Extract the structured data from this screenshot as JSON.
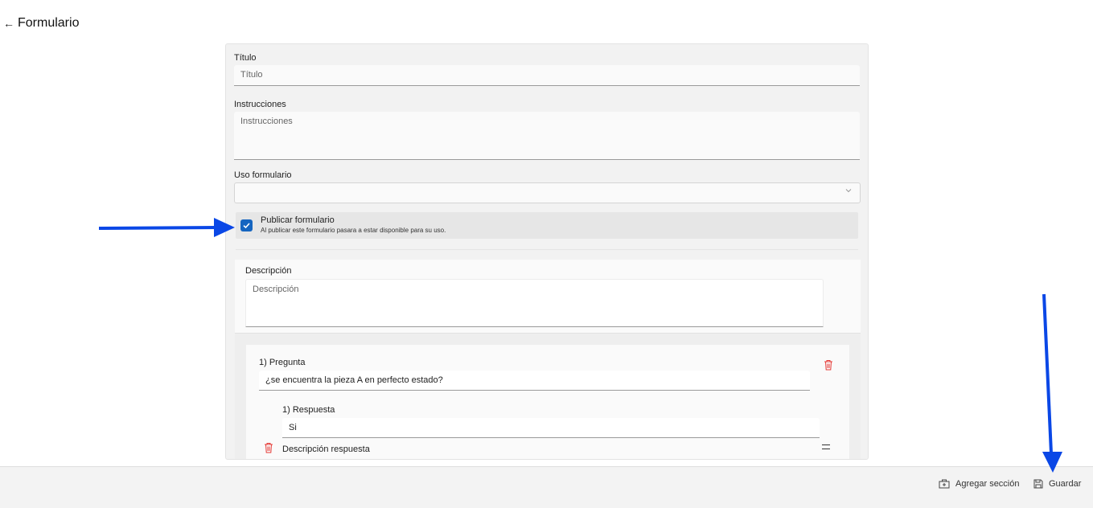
{
  "header": {
    "back_icon": "arrow-left-icon",
    "title": "Formulario"
  },
  "form": {
    "titulo_label": "Título",
    "titulo_placeholder": "Título",
    "instrucciones_label": "Instrucciones",
    "instrucciones_placeholder": "Instrucciones",
    "uso_label": "Uso formulario",
    "uso_value": "",
    "publicar_label": "Publicar formulario",
    "publicar_help": "Al publicar este formulario pasara a estar disponible para su uso.",
    "publicar_checked": true
  },
  "section": {
    "descripcion_label": "Descripción",
    "descripcion_placeholder": "Descripción",
    "question": {
      "label": "1) Pregunta",
      "value": "¿se encuentra la pieza A en perfecto estado?",
      "answer_label": "1) Respuesta",
      "answer_value": "Si",
      "answer_desc_label": "Descripción respuesta"
    }
  },
  "footer": {
    "add_section_label": "Agregar sección",
    "save_label": "Guardar"
  },
  "colors": {
    "accent": "#1565c0",
    "danger": "#e53935",
    "annotation": "#0a47e6"
  }
}
